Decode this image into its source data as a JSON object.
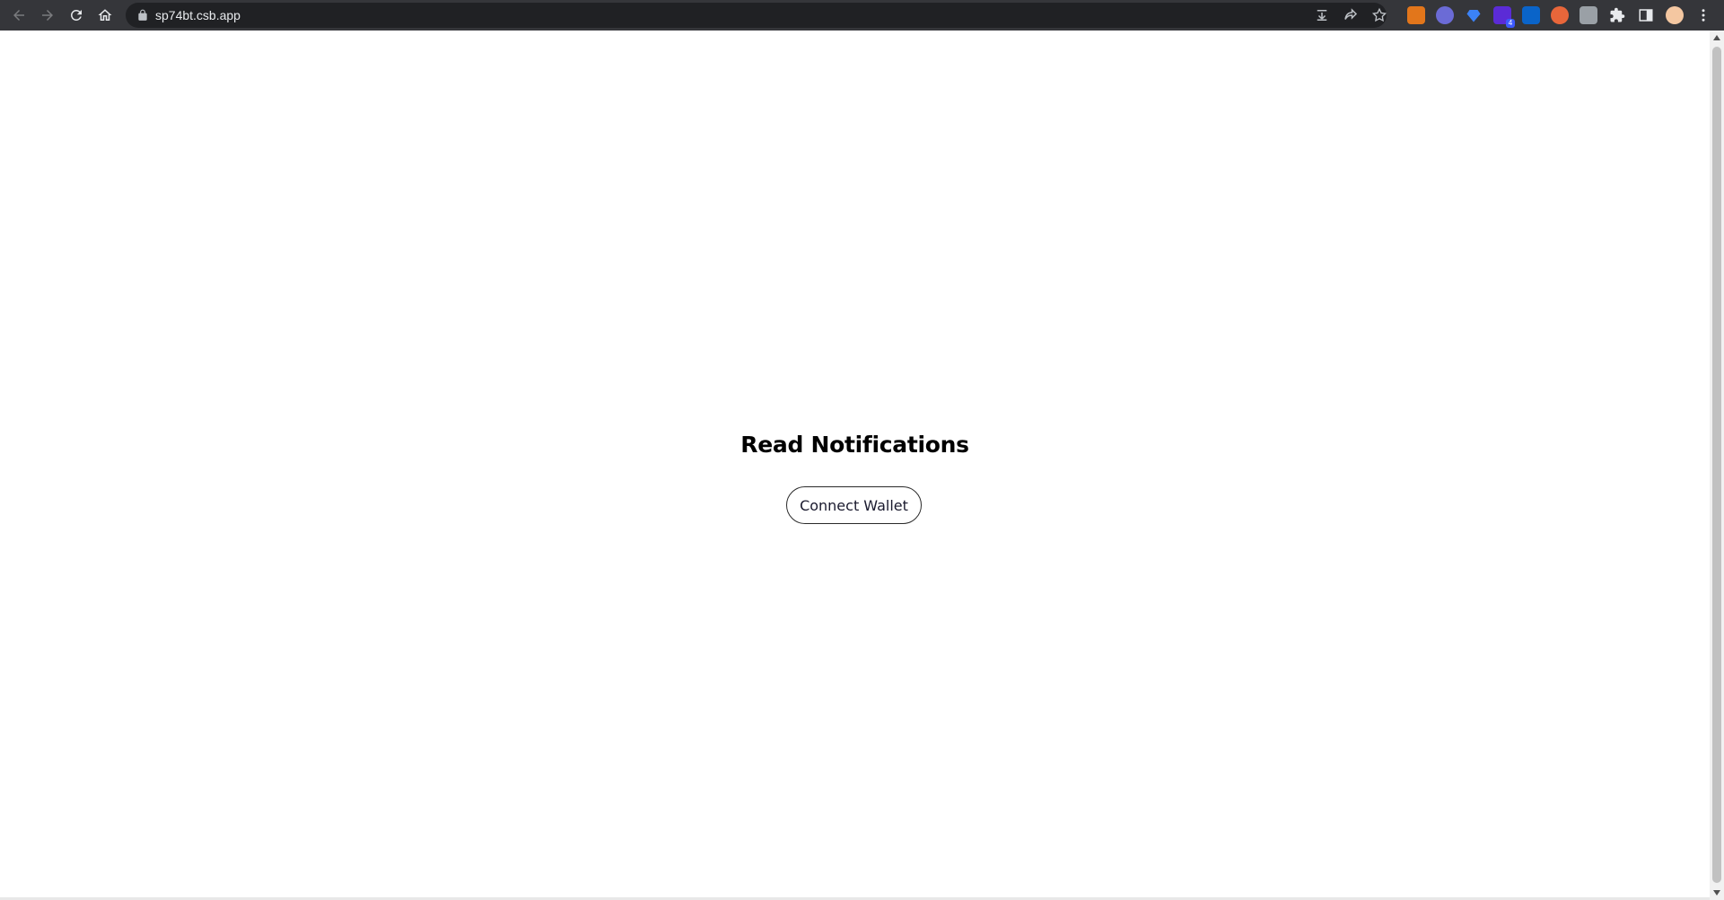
{
  "browser": {
    "url": "sp74bt.csb.app",
    "extensions": [
      {
        "name": "metamask-fox",
        "color": "#e2761b"
      },
      {
        "name": "ghost-extension",
        "color": "#6b6bd6"
      },
      {
        "name": "diamond-extension",
        "color": "#3b82f6"
      },
      {
        "name": "wallet-extension",
        "color": "#5b2bd6",
        "badge": "4"
      },
      {
        "name": "outlook-extension",
        "color": "#0a64c9"
      },
      {
        "name": "chart-extension",
        "color": "#e8663a"
      },
      {
        "name": "photo-extension",
        "color": "#9aa0a6"
      }
    ]
  },
  "page": {
    "title": "Read Notifications",
    "connect_button_label": "Connect Wallet"
  }
}
